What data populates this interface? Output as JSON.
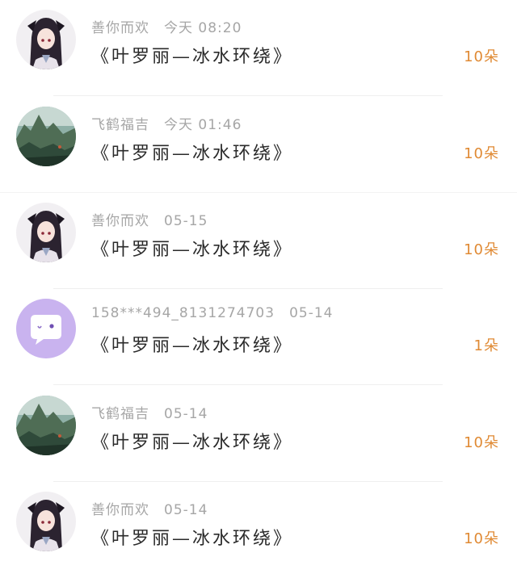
{
  "messages": [
    {
      "sender": "善你而欢",
      "time": "今天 08:20",
      "title": "《叶罗丽—冰水环绕》",
      "count": "10朵",
      "avatar": "anime-girl-avatar"
    },
    {
      "sender": "飞鹤福吉",
      "time": "今天 01:46",
      "title": "《叶罗丽—冰水环绕》",
      "count": "10朵",
      "avatar": "landscape-avatar"
    },
    {
      "sender": "善你而欢",
      "time": "05-15",
      "title": "《叶罗丽—冰水环绕》",
      "count": "10朵",
      "avatar": "anime-girl-avatar"
    },
    {
      "sender": "158***494_8131274703",
      "time": "05-14",
      "title": "《叶罗丽—冰水环绕》",
      "count": "1朵",
      "avatar": "default-chat-avatar"
    },
    {
      "sender": "飞鹤福吉",
      "time": "05-14",
      "title": "《叶罗丽—冰水环绕》",
      "count": "10朵",
      "avatar": "landscape-avatar"
    },
    {
      "sender": "善你而欢",
      "time": "05-14",
      "title": "《叶罗丽—冰水环绕》",
      "count": "10朵",
      "avatar": "anime-girl-avatar"
    }
  ],
  "colors": {
    "count_accent": "#e08a34",
    "meta_gray": "#a6a6a6",
    "default_avatar_bg": "#c9b3ef"
  }
}
